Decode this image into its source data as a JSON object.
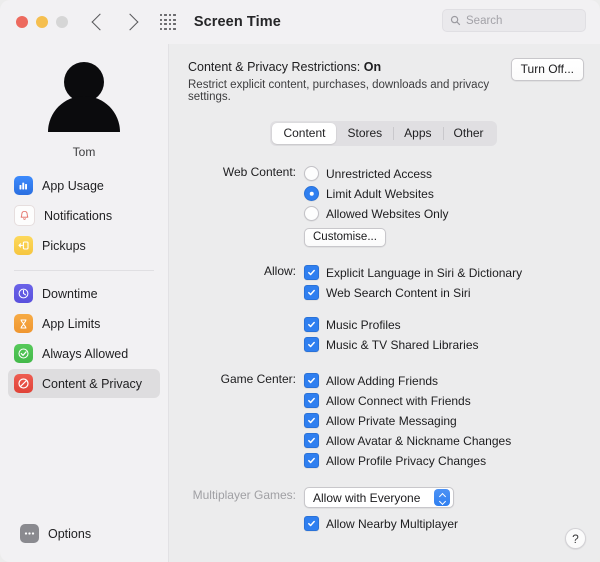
{
  "window": {
    "title": "Screen Time",
    "traffic_lights": [
      "close-red",
      "minimize-yellow",
      "zoom-gray"
    ],
    "nav_back": "back-arrow",
    "nav_forward": "forward-arrow",
    "grid_icon": "apps-grid-icon"
  },
  "search": {
    "placeholder": "Search",
    "value": "",
    "icon": "search-icon"
  },
  "sidebar": {
    "account": {
      "name": "Tom",
      "avatar": "user-silhouette-avatar"
    },
    "group_one": [
      {
        "label": "App Usage",
        "icon": "bar-chart-icon"
      },
      {
        "label": "Notifications",
        "icon": "bell-icon"
      },
      {
        "label": "Pickups",
        "icon": "pickups-icon"
      }
    ],
    "group_two": [
      {
        "label": "Downtime",
        "icon": "clock-moon-icon"
      },
      {
        "label": "App Limits",
        "icon": "hourglass-icon"
      },
      {
        "label": "Always Allowed",
        "icon": "check-circle-icon"
      },
      {
        "label": "Content & Privacy",
        "icon": "no-entry-icon"
      }
    ],
    "options": {
      "label": "Options",
      "icon": "ellipsis-icon"
    },
    "selected": "Content & Privacy"
  },
  "main": {
    "header": {
      "title_prefix": "Content & Privacy Restrictions:",
      "status": "On",
      "subtitle": "Restrict explicit content, purchases, downloads and privacy settings.",
      "turn_off_label": "Turn Off..."
    },
    "tabs": [
      {
        "label": "Content",
        "selected": true
      },
      {
        "label": "Stores",
        "selected": false
      },
      {
        "label": "Apps",
        "selected": false
      },
      {
        "label": "Other",
        "selected": false
      }
    ],
    "web_content": {
      "label": "Web Content:",
      "options": [
        {
          "label": "Unrestricted Access",
          "selected": false
        },
        {
          "label": "Limit Adult Websites",
          "selected": true
        },
        {
          "label": "Allowed Websites Only",
          "selected": false
        }
      ],
      "customise_label": "Customise..."
    },
    "allow": {
      "label": "Allow:",
      "items": [
        {
          "label": "Explicit Language in Siri & Dictionary",
          "checked": true
        },
        {
          "label": "Web Search Content in Siri",
          "checked": true
        }
      ],
      "items_second": [
        {
          "label": "Music Profiles",
          "checked": true
        },
        {
          "label": "Music & TV Shared Libraries",
          "checked": true
        }
      ]
    },
    "game_center": {
      "label": "Game Center:",
      "items": [
        {
          "label": "Allow Adding Friends",
          "checked": true
        },
        {
          "label": "Allow Connect with Friends",
          "checked": true
        },
        {
          "label": "Allow Private Messaging",
          "checked": true
        },
        {
          "label": "Allow Avatar & Nickname Changes",
          "checked": true
        },
        {
          "label": "Allow Profile Privacy Changes",
          "checked": true
        }
      ]
    },
    "multiplayer": {
      "label": "Multiplayer Games:",
      "label_disabled": true,
      "value": "Allow with Everyone",
      "nearby": {
        "label": "Allow Nearby Multiplayer",
        "checked": true
      }
    },
    "help_label": "?"
  },
  "colors": {
    "accent_blue": "#2f7ff0",
    "window_bg": "#ececed",
    "sidebar_bg": "#f2f1f3",
    "selected_row": "#dedddf"
  }
}
